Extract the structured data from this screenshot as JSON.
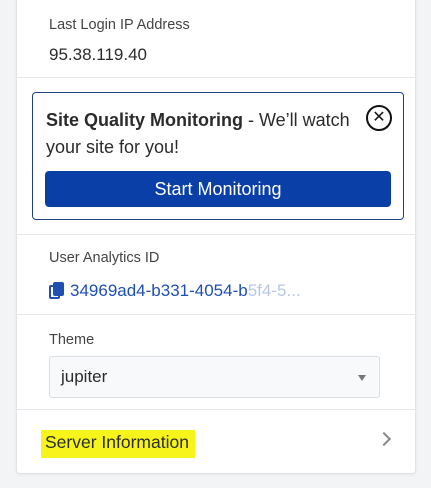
{
  "login": {
    "label": "Last Login IP Address",
    "ip": "95.38.119.40"
  },
  "monitoring": {
    "title": "Site Quality Monitoring",
    "description": " - We’ll watch your site for you!",
    "start_label": "Start Monitoring",
    "close_icon": "close-circle-icon",
    "accent": "#0a3fa8"
  },
  "analytics": {
    "label": "User Analytics ID",
    "id_visible": "34969ad4-b331-4054-b",
    "id_faded": "5f4-5...",
    "copy_icon": "copy-icon"
  },
  "theme": {
    "label": "Theme",
    "selected": "jupiter"
  },
  "server": {
    "label": "Server Information",
    "highlight": "#f6f41a"
  }
}
